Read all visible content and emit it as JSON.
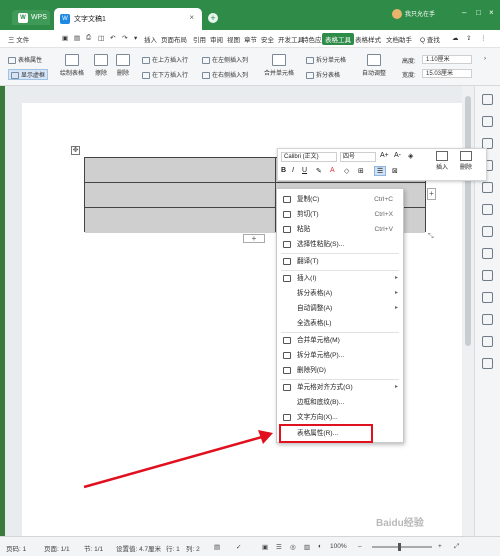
{
  "titlebar": {
    "wps_tab": "WPS",
    "doc_tab": "文字文稿1",
    "user": "我只允在手",
    "color": "#2f8c48"
  },
  "menubar": {
    "file": "三 文件",
    "items": [
      "插入",
      "页面布局",
      "引用",
      "审阅",
      "视图",
      "章节",
      "安全",
      "开发工具",
      "特色应用"
    ],
    "active": "表格工具",
    "after": [
      "表格样式",
      "文档助手"
    ],
    "search": "Q 查找"
  },
  "ribbon": {
    "table_props": "表格属性",
    "show_grid": "显示虚框",
    "draw_table": "绘制表格",
    "erase": "擦除",
    "delete": "删除",
    "insert_above": "在上方插入行",
    "insert_below": "在下方插入行",
    "insert_left": "在左侧插入列",
    "insert_right": "在右侧插入列",
    "merge_cells": "合并单元格",
    "split_cells": "拆分单元格",
    "split_table": "拆分表格",
    "auto_fit": "自动调整",
    "height_label": "高度:",
    "height_value": "1.10厘米",
    "width_label": "宽度:",
    "width_value": "15.03厘米"
  },
  "minitoolbar": {
    "font": "Calibri (正文)",
    "size": "四号",
    "grow": "A+",
    "shrink": "A-",
    "insert": "插入",
    "delete": "删除",
    "bold": "B",
    "italic": "I",
    "underline": "U"
  },
  "context_menu": {
    "items": [
      {
        "label": "复制(C)",
        "shortcut": "Ctrl+C"
      },
      {
        "label": "剪切(T)",
        "shortcut": "Ctrl+X"
      },
      {
        "label": "粘贴",
        "shortcut": "Ctrl+V"
      },
      {
        "label": "选择性粘贴(S)..."
      },
      {
        "label": "翻译(T)"
      },
      {
        "label": "插入(I)",
        "arrow": true
      },
      {
        "label": "拆分表格(A)",
        "arrow": true
      },
      {
        "label": "自动调整(A)",
        "arrow": true
      },
      {
        "label": "全选表格(L)"
      },
      {
        "label": "合并单元格(M)"
      },
      {
        "label": "拆分单元格(P)..."
      },
      {
        "label": "删除列(D)"
      },
      {
        "label": "单元格对齐方式(G)",
        "arrow": true
      },
      {
        "label": "边框和底纹(B)..."
      },
      {
        "label": "文字方向(X)..."
      },
      {
        "label": "表格属性(R)..."
      }
    ],
    "highlight_color": "#e0101e"
  },
  "statusbar": {
    "page": "页码: 1",
    "pages": "页面: 1/1",
    "section": "节: 1/1",
    "position": "设置值: 4.7厘米",
    "row": "行: 1",
    "col": "列: 2",
    "zoom": "100%"
  },
  "watermark": "Baidu经验"
}
